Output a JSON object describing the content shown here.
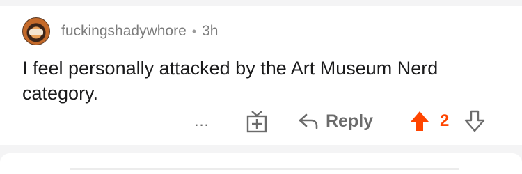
{
  "comment": {
    "author": "fuckingshadywhore",
    "separator": "•",
    "time": "3h",
    "text": "I feel personally attacked by the Art Museum Nerd category.",
    "avatar_icon": "avatar-image"
  },
  "actions": {
    "more_label": "...",
    "gift_icon": "gift-icon",
    "reply_icon": "reply-arrow-icon",
    "reply_label": "Reply",
    "upvote_icon": "upvote-arrow-icon",
    "vote_count": "2",
    "downvote_icon": "downvote-arrow-icon"
  },
  "colors": {
    "upvote_active": "#ff4500",
    "meta_text": "#7c7c7c",
    "body_text": "#1a1a1b",
    "background_strip": "#f4f4f5"
  }
}
